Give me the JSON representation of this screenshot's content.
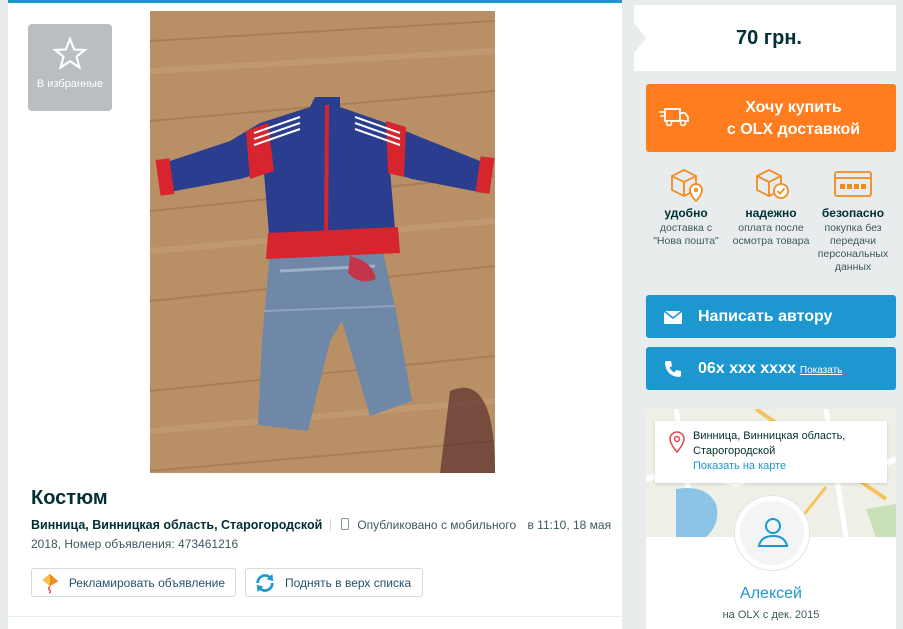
{
  "favorite": {
    "label": "В избранные",
    "icon": "star-icon"
  },
  "listing": {
    "title": "Костюм",
    "location": "Винница, Винницкая область, Старогородской",
    "published": "Опубликовано с мобильного",
    "published_time": "в 11:10, 18 мая 2018, Номер объявления: 473461216"
  },
  "actions": {
    "promote_label": "Рекламировать объявление",
    "raise_label": "Поднять в верх списка"
  },
  "price": "70 грн.",
  "buy": {
    "line1": "Хочу купить",
    "line2": "с OLX доставкой",
    "color": "#ff7d1f"
  },
  "features": [
    {
      "icon": "box-pin-icon",
      "title": "удобно",
      "desc": "доставка с \"Нова пошта\""
    },
    {
      "icon": "box-check-icon",
      "title": "надежно",
      "desc": "оплата после осмотра товара"
    },
    {
      "icon": "card-icon",
      "title": "безопасно",
      "desc": "покупка без передачи персональных данных"
    }
  ],
  "contact": {
    "write_label": "Написать автору",
    "phone": "06x xxx xxxx",
    "show_label": "Показать",
    "accent": "#1d97d0"
  },
  "map": {
    "address": "Винница, Винницкая область, Старогородской",
    "show_on_map": "Показать на карте"
  },
  "seller": {
    "name": "Алексей",
    "since": "на OLX с дек. 2015"
  }
}
